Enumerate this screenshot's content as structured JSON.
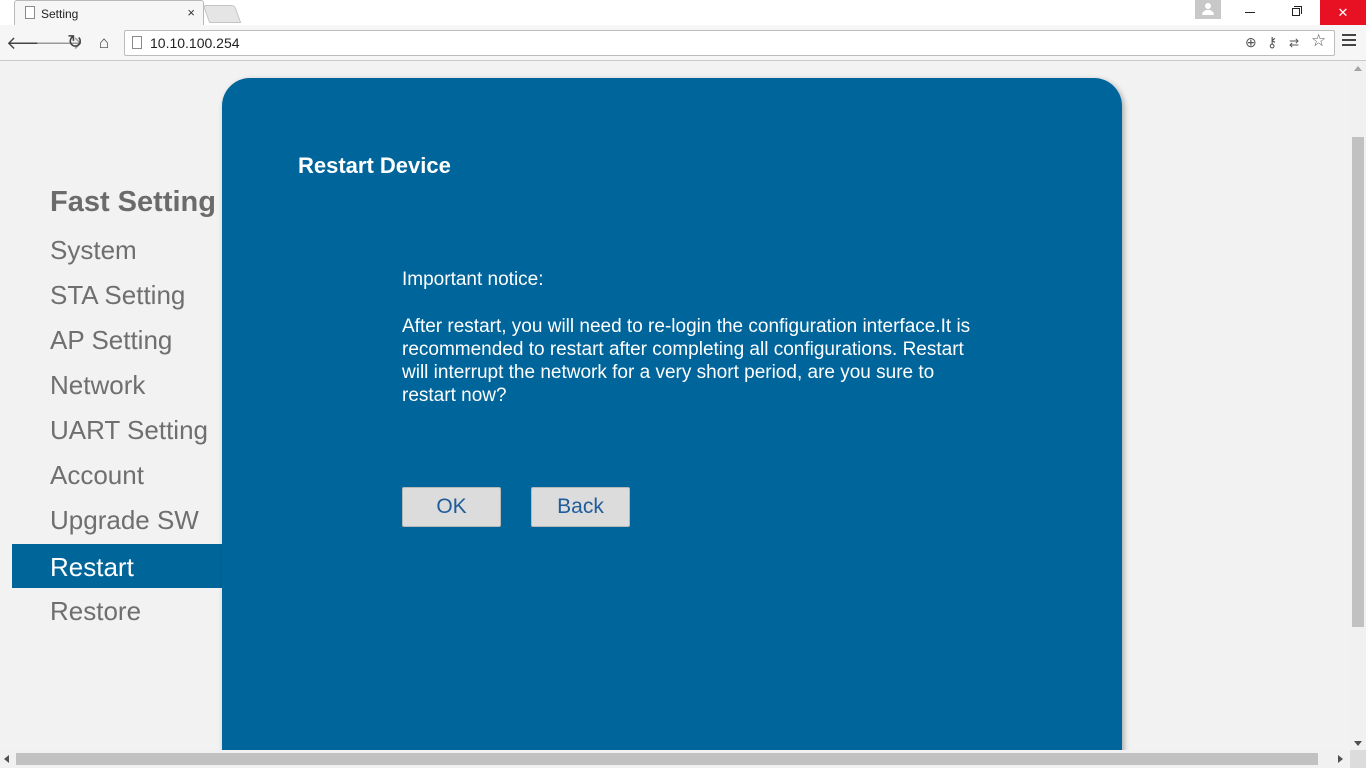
{
  "browser": {
    "tab_title": "Setting",
    "tab_close": "×",
    "url": "10.10.100.254",
    "window_close": "✕"
  },
  "sidebar": {
    "heading": "Fast Setting",
    "items": [
      {
        "label": "System",
        "active": false
      },
      {
        "label": "STA Setting",
        "active": false
      },
      {
        "label": "AP Setting",
        "active": false
      },
      {
        "label": "Network",
        "active": false
      },
      {
        "label": "UART Setting",
        "active": false
      },
      {
        "label": "Account",
        "active": false
      },
      {
        "label": "Upgrade SW",
        "active": false
      },
      {
        "label": "Restart",
        "active": true
      },
      {
        "label": "Restore",
        "active": false
      }
    ]
  },
  "panel": {
    "title": "Restart Device",
    "notice_title": "Important notice:",
    "notice_body": "After restart, you will need to re-login the configuration interface.It is recommended to restart after completing all configurations. Restart will interrupt the network for a very short period, are you sure to restart now?",
    "ok_label": "OK",
    "back_label": "Back"
  },
  "colors": {
    "panel_bg": "#00659b",
    "active_item_bg": "#006699",
    "page_bg": "#f2f2f2",
    "close_red": "#e81123"
  },
  "icons": [
    "page-icon",
    "back-arrow-icon",
    "forward-arrow-icon",
    "reload-icon",
    "home-icon",
    "zoom-icon",
    "key-icon",
    "translate-icon",
    "star-icon",
    "menu-icon",
    "profile-icon"
  ]
}
